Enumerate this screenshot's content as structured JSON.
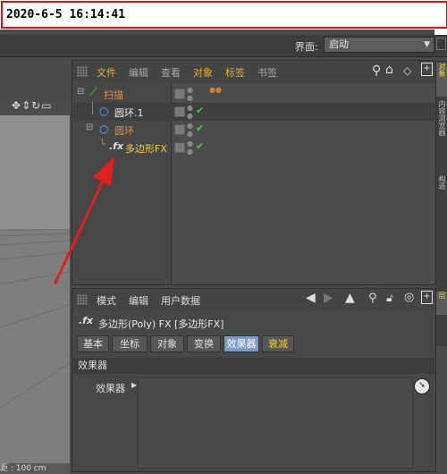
{
  "timestamp": "2020-6-5 16:14:41",
  "layout": {
    "label": "界面:",
    "value": "启动"
  },
  "viewport": {
    "footer": "距 : 100 cm"
  },
  "object_manager": {
    "menu": [
      "文件",
      "编辑",
      "查看",
      "对象",
      "标签",
      "书签"
    ],
    "objects": [
      {
        "name": "扫描",
        "color": "#e09040"
      },
      {
        "name": "圆环.1",
        "color": "#e8e8e8"
      },
      {
        "name": "圆环",
        "color": "#e09040"
      },
      {
        "name": "多边形FX",
        "color": "#f0d040"
      }
    ]
  },
  "right_tabs": [
    "对象",
    "内容浏览器",
    "构造",
    "层"
  ],
  "attribute_manager": {
    "menu": [
      "模式",
      "编辑",
      "用户数据"
    ],
    "title": "多边形(Poly) FX [多边形FX]",
    "tabs": [
      "基本",
      "坐标",
      "对象",
      "变换",
      "效果器",
      "衰减"
    ],
    "active_tab": "效果器",
    "section": "效果器",
    "field_label": "效果器"
  },
  "colors": {
    "accent_orange": "#e09040",
    "accent_yellow": "#f0d040",
    "check_green": "#3ad13a",
    "annotation_red": "#e02020"
  }
}
